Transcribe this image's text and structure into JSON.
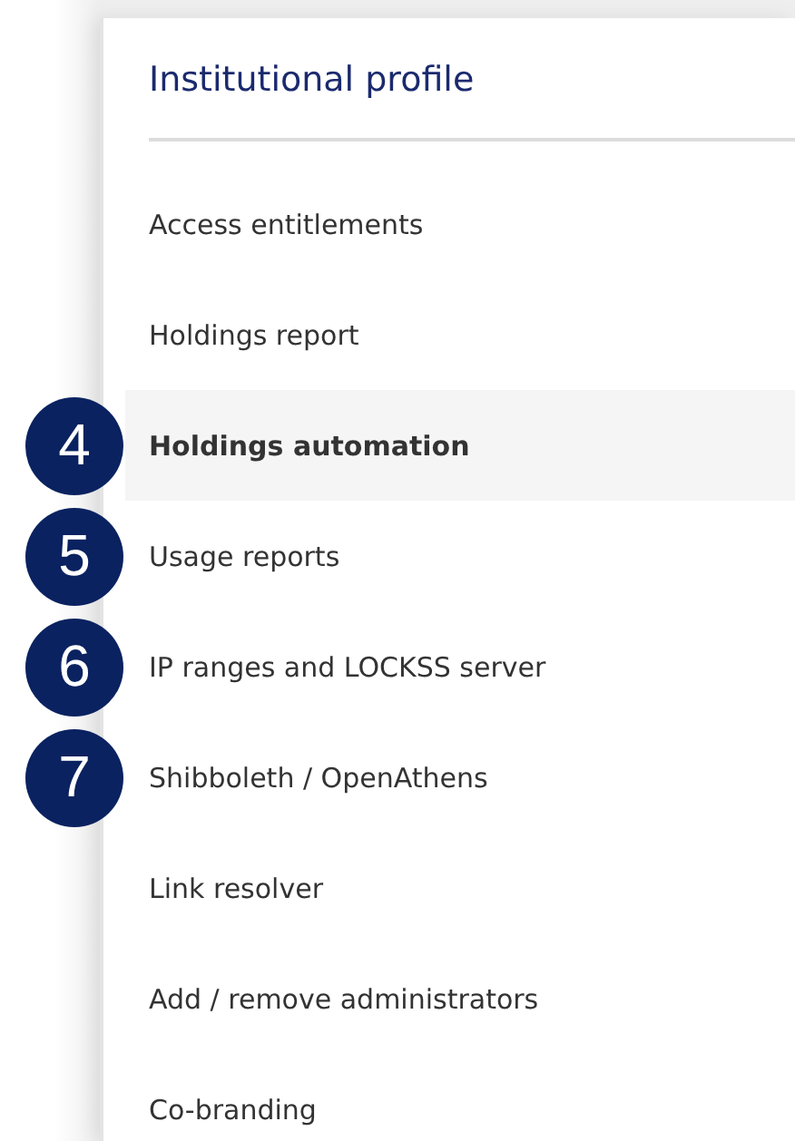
{
  "heading": "Institutional profile",
  "items": [
    {
      "label": "Access entitlements",
      "selected": false
    },
    {
      "label": "Holdings report",
      "selected": false
    },
    {
      "label": "Holdings automation",
      "selected": true,
      "callout": "4"
    },
    {
      "label": "Usage reports",
      "selected": false,
      "callout": "5"
    },
    {
      "label": "IP ranges and LOCKSS server",
      "selected": false,
      "callout": "6"
    },
    {
      "label": "Shibboleth / OpenAthens",
      "selected": false,
      "callout": "7"
    },
    {
      "label": "Link resolver",
      "selected": false
    },
    {
      "label": "Add / remove administrators",
      "selected": false
    },
    {
      "label": "Co-branding",
      "selected": false
    }
  ]
}
